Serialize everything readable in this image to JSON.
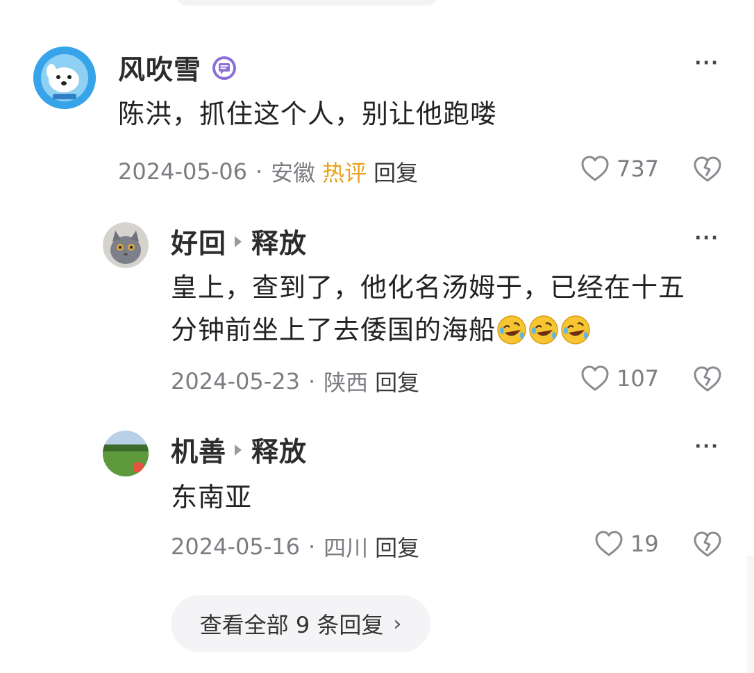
{
  "comments": [
    {
      "author": "风吹雪",
      "content": "陈洪，抓住这个人，别让他跑喽",
      "date": "2024-05-06",
      "location": "安徽",
      "hot_label": "热评",
      "reply_label": "回复",
      "likes": "737",
      "more_label": "···"
    }
  ],
  "replies": [
    {
      "author": "好回",
      "target": "释放",
      "content_line1": "皇上，查到了，他化名汤姆于，已经在十五",
      "content_line2": "分钟前坐上了去倭国的海船",
      "date": "2024-05-23",
      "location": "陕西",
      "reply_label": "回复",
      "likes": "107",
      "more_label": "···"
    },
    {
      "author": "机善",
      "target": "释放",
      "content": "东南亚",
      "date": "2024-05-16",
      "location": "四川",
      "reply_label": "回复",
      "likes": "19",
      "more_label": "···"
    }
  ],
  "meta_separator": "·",
  "view_all": {
    "label": "查看全部 9 条回复",
    "chevron": "›"
  },
  "icons": {
    "badge": "speech-bubble-badge-icon",
    "like": "heart-outline-icon",
    "dislike": "broken-heart-icon",
    "emoji": "rolling-laughing-emoji-icon"
  },
  "colors": {
    "hot": "#e7a21b",
    "meta": "#7c7c82",
    "badge": "#8b6fd6"
  }
}
